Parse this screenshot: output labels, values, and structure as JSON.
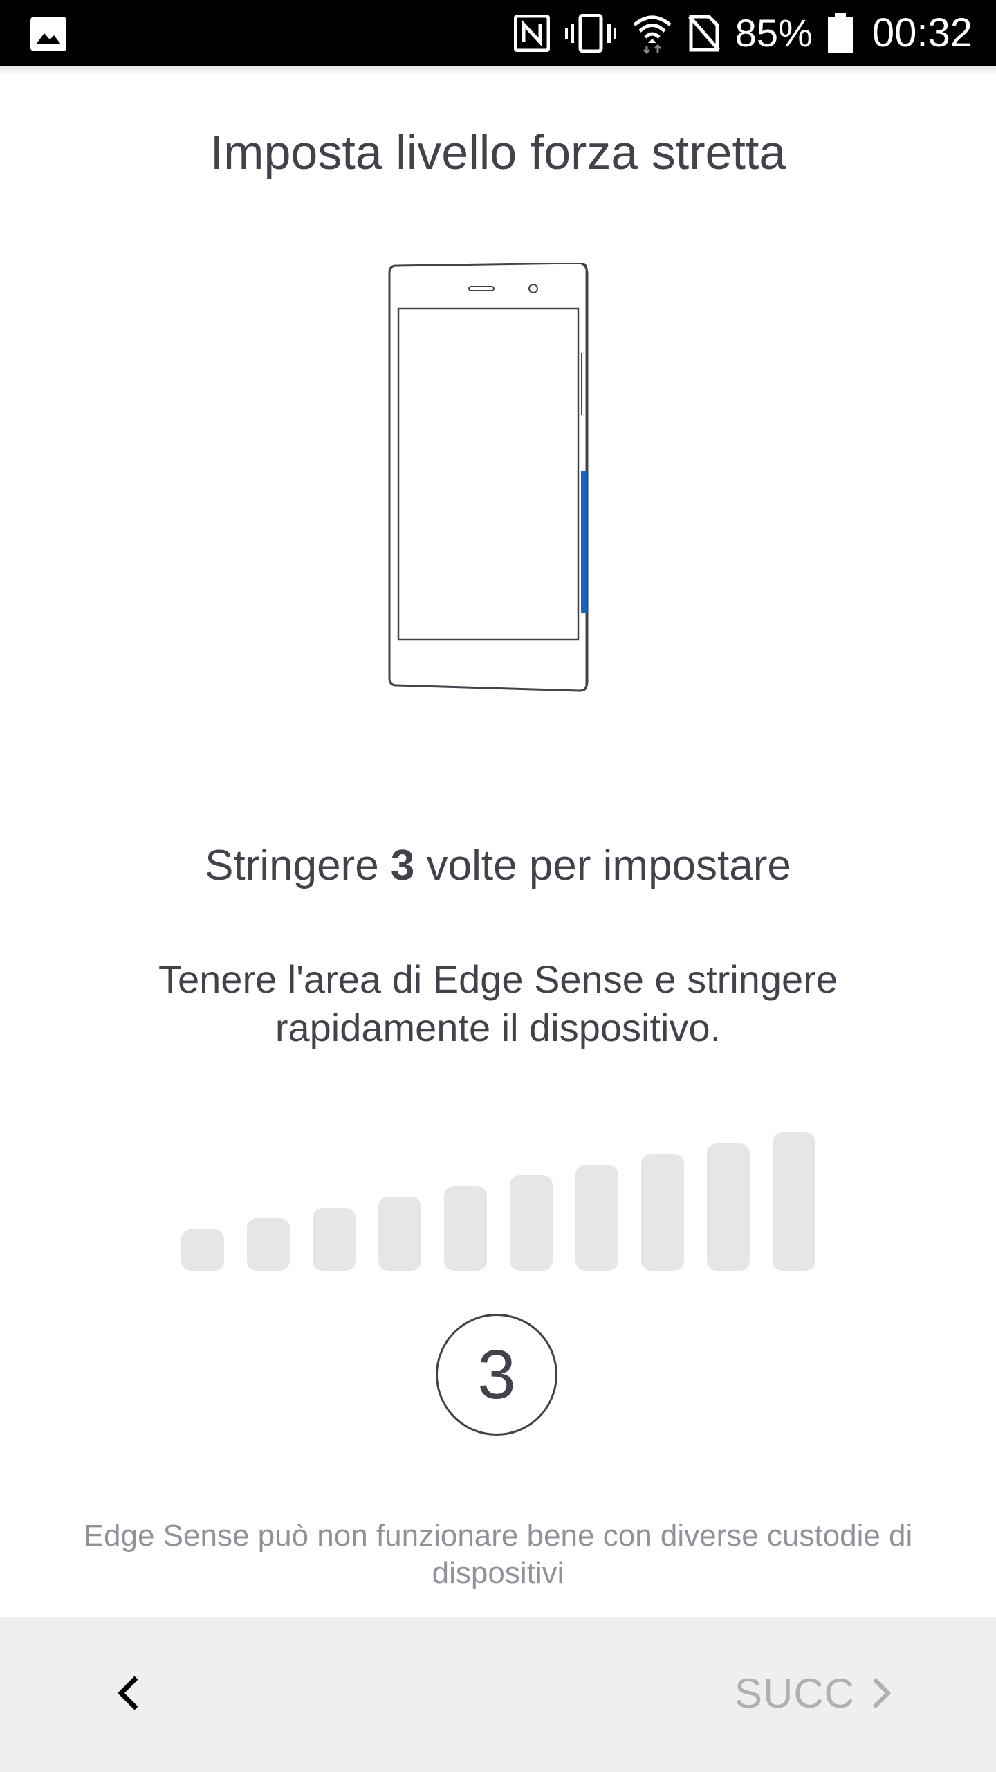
{
  "status_bar": {
    "battery": "85%",
    "time": "00:32",
    "icons": [
      "image-notification-icon",
      "nfc-icon",
      "vibrate-icon",
      "wifi-icon",
      "no-sim-icon",
      "battery-icon"
    ]
  },
  "page": {
    "title": "Imposta livello forza stretta",
    "instruction": {
      "prefix": "Stringere ",
      "count": "3",
      "suffix": " volte per impostare"
    },
    "description": "Tenere l'area di Edge Sense e stringere rapidamente il dispositivo.",
    "squeeze_level": {
      "levels": 10,
      "active": 0
    },
    "remaining_squeezes": "3",
    "warning": "Edge Sense può non funzionare bene con diverse custodie di dispositivi"
  },
  "nav": {
    "next_label": "SUCC"
  },
  "colors": {
    "accent": "#1565c0",
    "text": "#41434a",
    "bar_inactive": "#e6e6e6",
    "nav_bg": "#efefef",
    "disabled": "#aeb0b3"
  }
}
